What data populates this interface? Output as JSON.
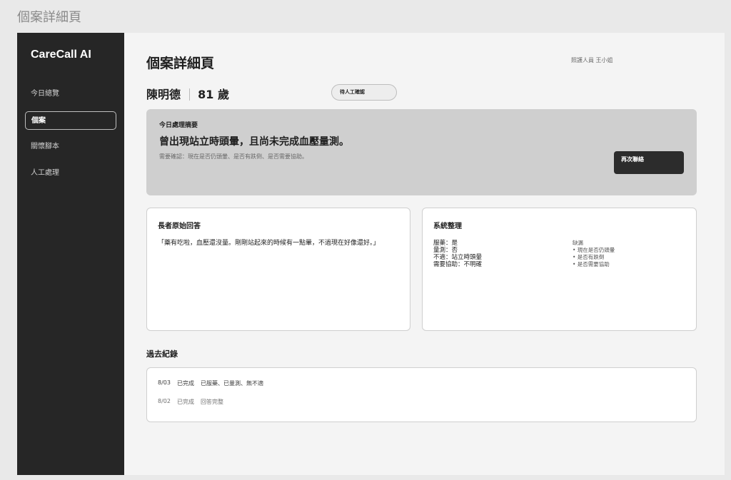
{
  "frame_title": "個案詳細頁",
  "sidebar": {
    "brand": "CareCall AI",
    "items": [
      {
        "label": "今日總覽",
        "active": false
      },
      {
        "label": "個案",
        "active": true
      },
      {
        "label": "關懷腳本",
        "active": false
      },
      {
        "label": "人工處理",
        "active": false
      }
    ]
  },
  "header": {
    "title": "個案詳細頁",
    "caregiver": "照護人員 王小姐",
    "patient_name": "陳明德",
    "patient_age": "81 歲",
    "status": "待人工確認"
  },
  "summary": {
    "label": "今日處理摘要",
    "headline": "曾出現站立時頭暈，且尚未完成血壓量測。",
    "detail": "需要確認：現在是否仍頭暈、是否有跌倒、是否需要協助。",
    "button": "再次聯絡"
  },
  "raw_answer": {
    "title": "長者原始回答",
    "text": "「藥有吃啦，血壓還沒量。剛剛站起來的時候有一點暈，不過現在好像還好。」"
  },
  "system": {
    "title": "系統整理",
    "facts": [
      "服藥：是",
      "量測：否",
      "不適：站立時頭暈",
      "需要協助：不明確"
    ],
    "missing_title": "缺漏",
    "missing": [
      "• 現在是否仍頭暈",
      "• 是否有跌倒",
      "• 是否需要協助"
    ]
  },
  "history": {
    "title": "過去紀錄",
    "rows": [
      {
        "date": "8/03",
        "status": "已完成",
        "note": "已服藥、已量測、無不適"
      },
      {
        "date": "8/02",
        "status": "已完成",
        "note": "回答完整"
      }
    ]
  },
  "colors": {
    "sidebar": "#262626",
    "summary_bg": "#cfcfcf",
    "button": "#2c2c2c"
  }
}
